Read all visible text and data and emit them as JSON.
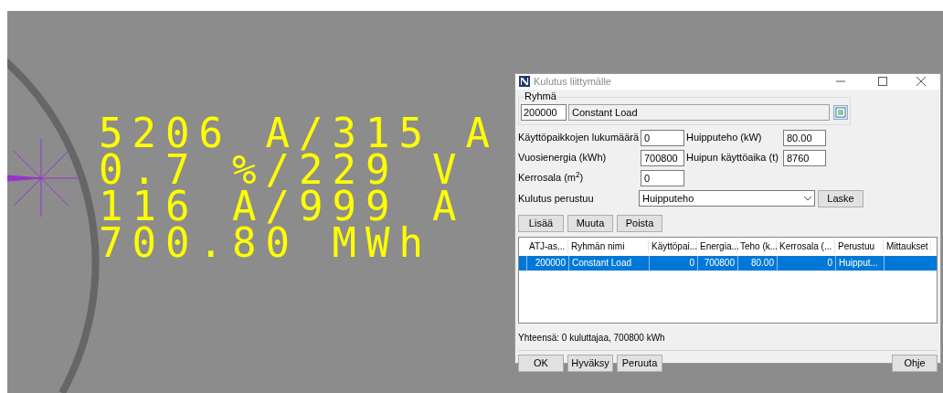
{
  "canvas": {
    "labels": [
      "5206 A/315 A",
      "0.7 %/229 V",
      "116 A/999 A",
      "700.80 MWh"
    ]
  },
  "dialog": {
    "title": "Kulutus liittymälle",
    "group": {
      "legend": "Ryhmä",
      "code": "200000",
      "name": "Constant Load"
    },
    "fields": [
      {
        "label": "Käyttöpaikkojen lukumäärä",
        "value": "0"
      },
      {
        "label": "Huipputeho (kW)",
        "value": "80.00"
      },
      {
        "label": "Vuosienergia (kWh)",
        "value": "700800"
      },
      {
        "label": "Huipun käyttöaika (t)",
        "value": "8760"
      },
      {
        "label": "Kerrosala (m$^{2}$)",
        "value": "0"
      }
    ],
    "basis": {
      "label": "Kulutus perustuu",
      "value": "Huipputeho",
      "button": "Laske"
    },
    "actions": [
      "Lisää",
      "Muuta",
      "Poista"
    ],
    "table": {
      "columns": [
        "ATJ-as...",
        "Ryhmän nimi",
        "Käyttöpai...",
        "Energia...",
        "Teho (k...",
        "Kerrosala (...",
        "Perustuu",
        "Mittaukset"
      ],
      "rows": [
        {
          "cells": [
            "200000",
            "Constant Load",
            "0",
            "700800",
            "80.00",
            "0",
            "Huipput...",
            ""
          ],
          "selected": true
        }
      ]
    },
    "summary": "Yhteensä: 0 kuluttajaa, 700800 kWh",
    "footer_buttons": [
      "OK",
      "Hyväksy",
      "Peruuta"
    ],
    "help_button": "Ohje"
  }
}
